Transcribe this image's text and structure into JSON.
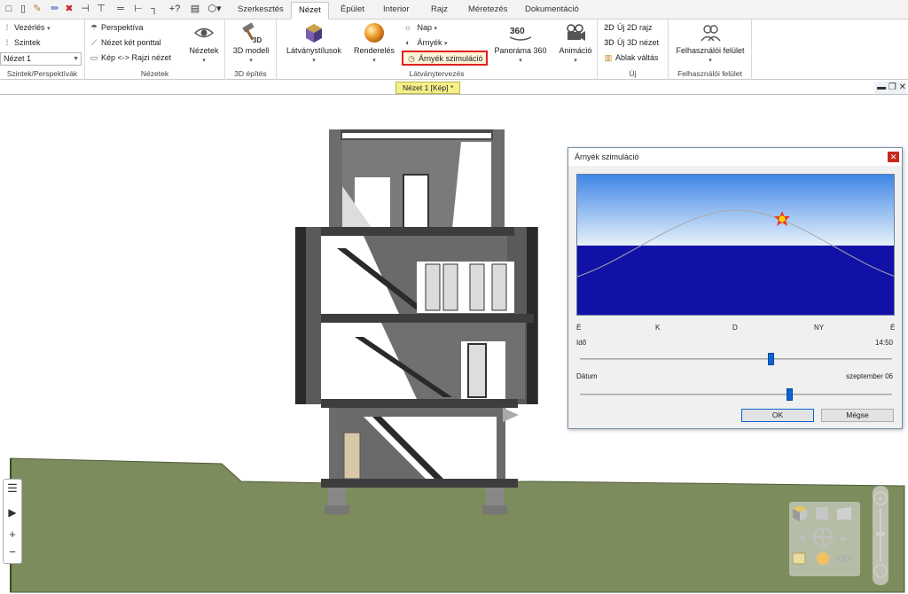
{
  "tabs": [
    "Szerkesztés",
    "Nézet",
    "Épület",
    "Interior",
    "Rajz",
    "Méretezés",
    "Dokumentáció"
  ],
  "active_tab": "Nézet",
  "ribbon": {
    "levels_group": {
      "label": "Szintek/Perspektívák",
      "control": "Vezérlés",
      "levels": "Szintek",
      "combo_value": "Nézet 1"
    },
    "views_group": {
      "label": "Nézetek",
      "perspective": "Perspektíva",
      "two_point": "Nézet két ponttal",
      "image_drawing": "Kép <-> Rajzi nézet",
      "views_button": "Nézetek"
    },
    "build3d_group": {
      "label": "3D építés",
      "model_button": "3D modell"
    },
    "visual_group": {
      "label": "Látványtervezés",
      "styles": "Látványstílusok",
      "render": "Renderelés",
      "sun": "Nap",
      "shadow": "Árnyék",
      "shadow_sim": "Árnyék szimuláció",
      "panorama": "Panoráma 360",
      "panorama_badge": "360",
      "animation": "Animáció"
    },
    "new_group": {
      "label": "Új",
      "new2d": "Új 2D rajz",
      "new3d": "Új 3D nézet",
      "switch": "Ablak váltás"
    },
    "ui_group": {
      "label": "Felhasználói felület",
      "ui_button": "Felhasználói felület"
    }
  },
  "view_tab_label": "Nézet 1 [Kép] *",
  "dialog": {
    "title": "Árnyék szimuláció",
    "compass": [
      "É",
      "K",
      "D",
      "NY",
      "É"
    ],
    "time_label": "Idő",
    "time_value": "14:50",
    "time_fraction": 0.61,
    "date_label": "Dátum",
    "date_value": "szeptember 06",
    "date_fraction": 0.67,
    "ok": "OK",
    "cancel": "Mégse"
  },
  "colors": {
    "sky_top": "#3e86e6",
    "ground": "#1111a8",
    "terrain": "#7d8c5c",
    "highlight": "#e02020",
    "slider": "#0a64d4"
  }
}
